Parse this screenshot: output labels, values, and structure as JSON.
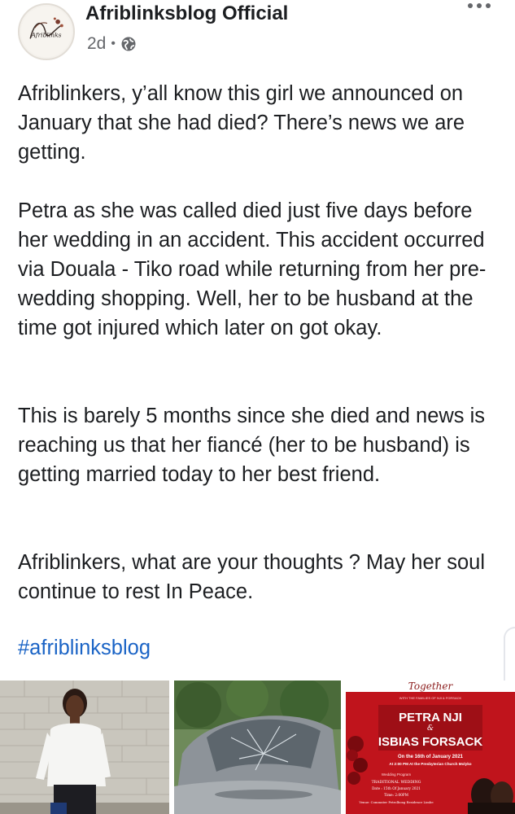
{
  "header": {
    "page_name": "Afriblinksblog Official",
    "time": "2d",
    "separator": "•",
    "avatar_text": "Afriblinks",
    "more_icon": "more-horizontal-icon",
    "audience_icon": "globe-icon"
  },
  "post": {
    "paragraphs": [
      "Afriblinkers, y’all know this girl we announced\non January that she had died? There’s news we\nare getting.",
      "Petra as she was called died just five days\nbefore her wedding in an accident. This\naccident occurred via Douala - Tiko road while\nreturning from her pre-wedding shopping. Well,\nher to be husband at the time got injured which\nlater on got okay.",
      "This is barely 5 months since she died and\nnews is reaching us that her fiancé (her to be\nhusband) is getting married today to her best\nfriend.",
      "Afriblinkers, what are your thoughts ? May her\nsoul continue to rest In Peace."
    ],
    "hashtag": "#afriblinksblog"
  },
  "gallery": {
    "invite": {
      "top_script": "Together",
      "family_line": "WITH THE FAMILIES OF NJI & FORSACK",
      "bride": "PETRA NJI",
      "ampersand": "&",
      "groom": "ISBIAS FORSACK",
      "date_line": "On the 16th of January 2021",
      "time_line": "At 2:00 PM At the Presbyterian Church Molyko",
      "program_title": "Wedding Program",
      "traditional": "TRADITIONAL WEDDING",
      "trad_date": "Date : 15th Of January 2021",
      "trad_time": "Time: 2:00PM",
      "venue": "Venue: Commuter Petrolbong Residence Limbe"
    }
  },
  "colors": {
    "text": "#1c1e21",
    "secondary": "#65676b",
    "link": "#1b64c6",
    "invite_red": "#c0141c"
  }
}
